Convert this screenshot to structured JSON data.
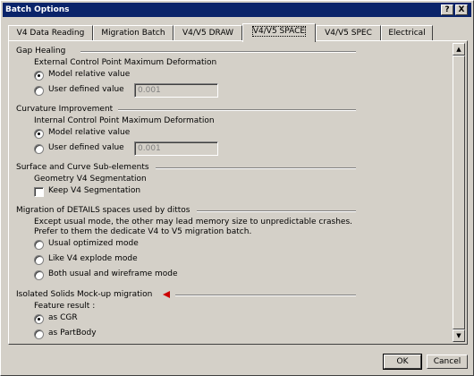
{
  "window": {
    "title": "Batch Options",
    "help_glyph": "?",
    "close_glyph": "X"
  },
  "tabs": [
    "V4 Data Reading",
    "Migration Batch",
    "V4/V5 DRAW",
    "V4/V5 SPACE",
    "V4/V5 SPEC",
    "Electrical"
  ],
  "active_tab": "V4/V5 SPACE",
  "gap_healing": {
    "title": "Gap Healing",
    "subtitle": "External Control Point Maximum Deformation",
    "model_relative": "Model relative value",
    "user_defined": "User defined value",
    "value": "0.001",
    "selected": "model_relative"
  },
  "curvature": {
    "title": "Curvature Improvement",
    "subtitle": "Internal Control Point Maximum Deformation",
    "model_relative": "Model relative value",
    "user_defined": "User defined value",
    "value": "0.001",
    "selected": "model_relative"
  },
  "surface": {
    "title": "Surface and Curve Sub-elements",
    "subtitle": "Geometry V4 Segmentation",
    "keep_label": "Keep V4 Segmentation",
    "keep_checked": false
  },
  "details": {
    "title": "Migration of DETAILS spaces used by dittos",
    "line1": "Except usual mode, the other may lead memory size to unpredictable crashes.",
    "line2": "Prefer to them the dedicate V4 to V5 migration batch.",
    "opt1": "Usual optimized mode",
    "opt2": "Like V4 explode mode",
    "opt3": "Both usual and wireframe mode",
    "selected": "none"
  },
  "isolated": {
    "title": "Isolated Solids Mock-up migration",
    "subtitle": "Feature result :",
    "opt1": "as CGR",
    "opt2": "as PartBody",
    "selected": "as CGR",
    "marker_color": "#cc0000"
  },
  "buttons": {
    "ok": "OK",
    "cancel": "Cancel"
  },
  "colors": {
    "titlebar": "#0a246a",
    "face": "#d4d0c8"
  },
  "scrollbar": {
    "up_glyph": "▲",
    "down_glyph": "▼"
  }
}
